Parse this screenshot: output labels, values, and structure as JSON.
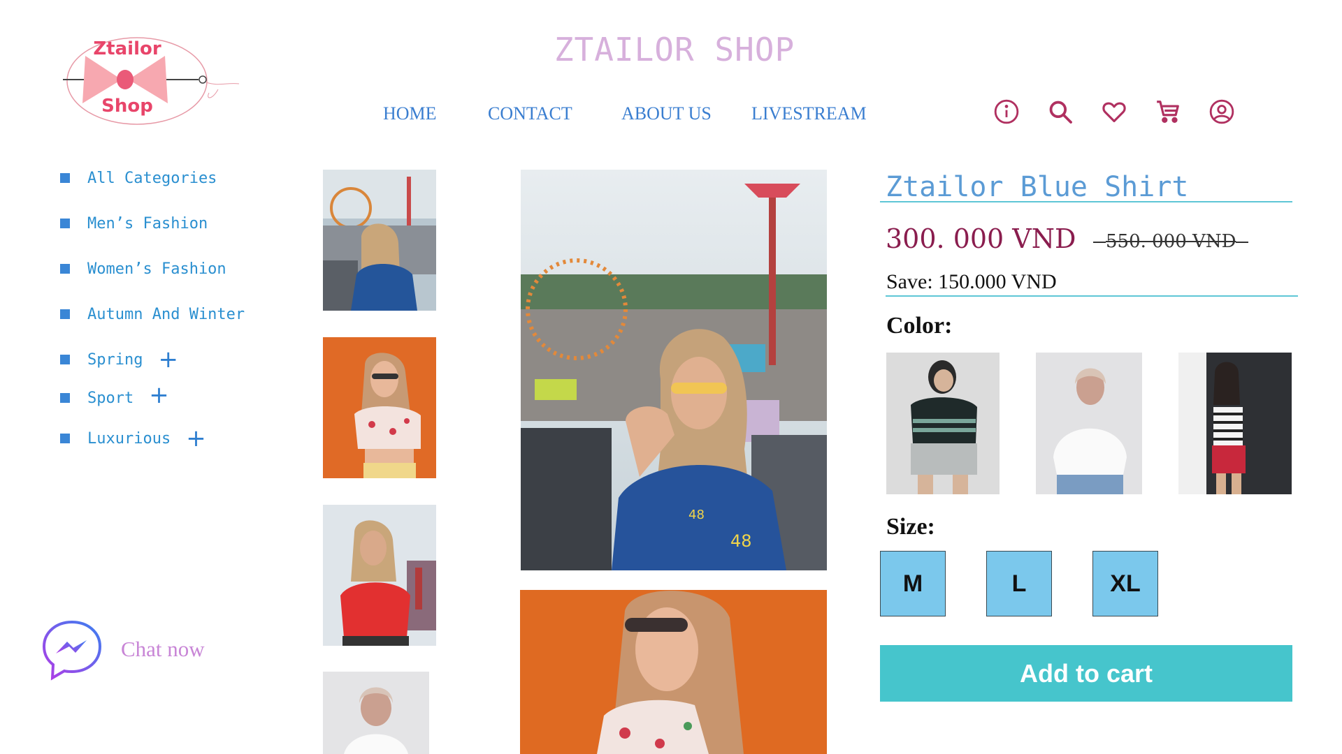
{
  "logo": {
    "text_top": "Ztailor",
    "text_bottom": "Shop"
  },
  "header": {
    "title": "ZTAILOR SHOP",
    "nav": [
      "HOME",
      "CONTACT",
      "ABOUT US",
      "LIVESTREAM"
    ],
    "icons": [
      "info-icon",
      "search-icon",
      "heart-icon",
      "cart-icon",
      "user-icon"
    ],
    "icon_color": "#b03060"
  },
  "sidebar": {
    "categories": [
      {
        "label": "All Categories",
        "expandable": false
      },
      {
        "label": "Men’s Fashion",
        "expandable": false
      },
      {
        "label": "Women’s Fashion",
        "expandable": false
      },
      {
        "label": "Autumn And Winter",
        "expandable": false
      },
      {
        "label": "Spring",
        "expandable": true,
        "toggle": "+"
      },
      {
        "label": "Sport",
        "expandable": true,
        "toggle": "+"
      },
      {
        "label": "Luxurious",
        "expandable": true,
        "toggle": "+"
      }
    ]
  },
  "chat": {
    "label": "Chat now",
    "icon": "messenger-icon"
  },
  "gallery": {
    "thumbnails": [
      "thumbnail-amusement-park-blue-shirt",
      "thumbnail-orange-floral-top",
      "thumbnail-red-top-fair",
      "thumbnail-white-shirt-headscarf"
    ],
    "main_images": [
      "main-photo-amusement-park-blue-shirt",
      "main-photo-orange-floral-top"
    ]
  },
  "product": {
    "title": "Ztailor Blue Shirt",
    "price": "300. 000  VND",
    "old_price": "550. 000  VND",
    "save": "Save: 150.000 VND",
    "color_label": "Color:",
    "colors": [
      "color-option-dark-striped",
      "color-option-white",
      "color-option-striped-red"
    ],
    "size_label": "Size:",
    "sizes": [
      "M",
      "L",
      "XL"
    ],
    "add_to_cart": "Add to cart",
    "accent_color": "#46c5cc",
    "size_button_color": "#7bc8ec"
  }
}
